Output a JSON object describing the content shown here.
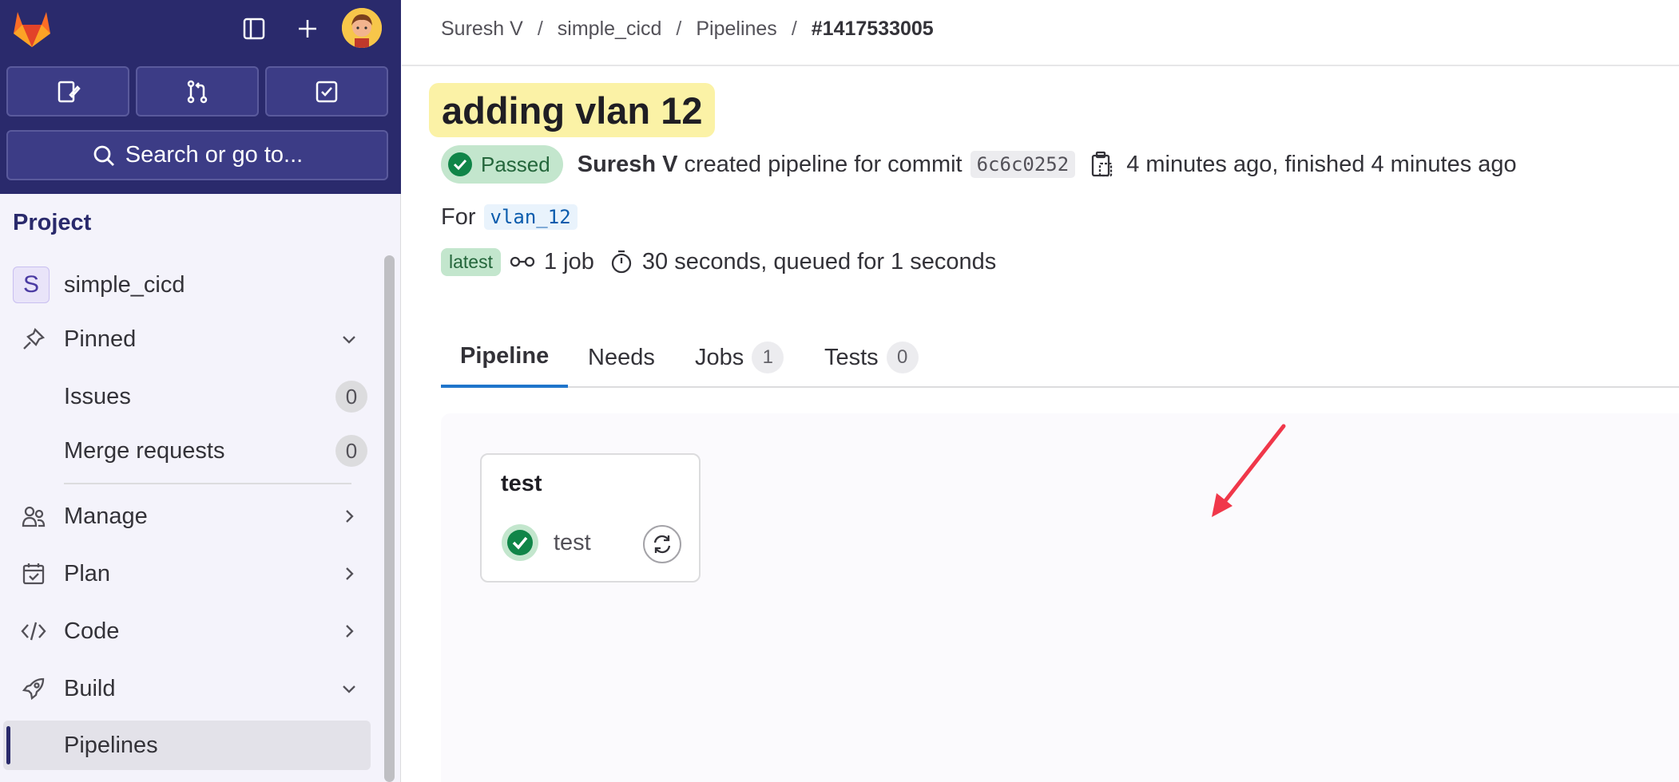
{
  "sidebar": {
    "section_title": "Project",
    "search_label": "Search or go to...",
    "project": {
      "initial": "S",
      "name": "simple_cicd"
    },
    "pinned": {
      "label": "Pinned",
      "items": [
        {
          "label": "Issues",
          "count": "0"
        },
        {
          "label": "Merge requests",
          "count": "0"
        }
      ]
    },
    "groups": [
      {
        "label": "Manage"
      },
      {
        "label": "Plan"
      },
      {
        "label": "Code"
      },
      {
        "label": "Build"
      }
    ],
    "active_item": "Pipelines"
  },
  "breadcrumb": {
    "items": [
      "Suresh V",
      "simple_cicd",
      "Pipelines"
    ],
    "current": "#1417533005",
    "separator": "/"
  },
  "pipeline": {
    "title": "adding vlan 12",
    "status": "Passed",
    "author": "Suresh V",
    "action_text": "created pipeline for commit",
    "commit_sha": "6c6c0252",
    "time_text": "4 minutes ago, finished 4 minutes ago",
    "for_label": "For",
    "ref": "vlan_12",
    "latest_badge": "latest",
    "jobs_text": "1 job",
    "duration_text": "30 seconds, queued for 1 seconds"
  },
  "tabs": [
    {
      "label": "Pipeline"
    },
    {
      "label": "Needs"
    },
    {
      "label": "Jobs",
      "count": "1"
    },
    {
      "label": "Tests",
      "count": "0"
    }
  ],
  "graph": {
    "stage_title": "test",
    "job_name": "test"
  },
  "colors": {
    "sidebar_top": "#2a2a6c",
    "success": "#108548",
    "highlight_title": "#fbf2a6",
    "tab_active": "#1f75cb",
    "annotation_arrow": "#f0374a"
  }
}
